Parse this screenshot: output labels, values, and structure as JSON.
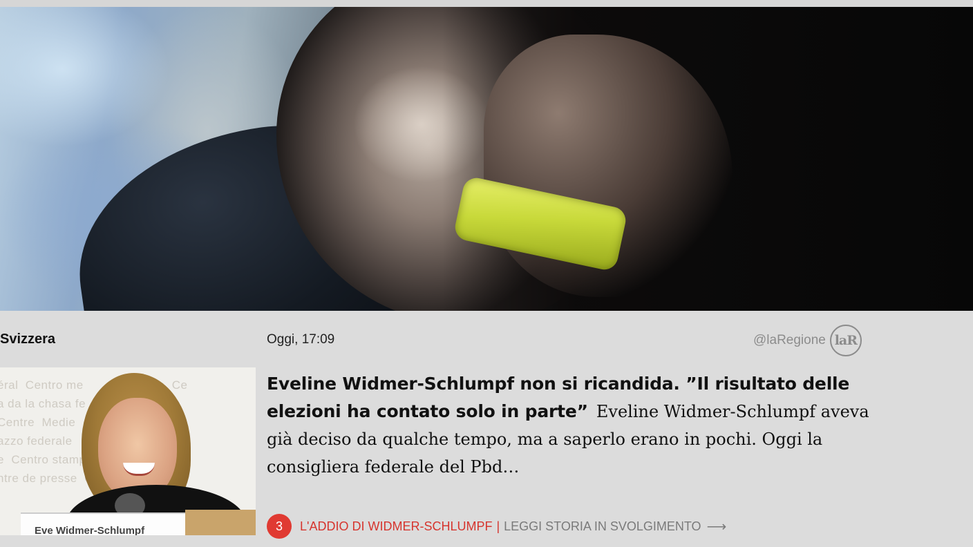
{
  "section": {
    "label": "Svizzera"
  },
  "article": {
    "timestamp": "Oggi, 17:09",
    "source_handle": "@laRegione",
    "source_logo_text": "laR",
    "headline": "Eveline Widmer-Schlumpf non si ricandida. ”Il risultato delle elezioni ha contato solo in parte”",
    "excerpt": "Eveline Widmer-Schlumpf aveva già deciso da qualche tempo, ma a saperlo erano in pochi. Oggi la consigliera federale del Pbd…"
  },
  "story": {
    "count": "3",
    "title": "L'ADDIO DI WIDMER-SCHLUMPF",
    "separator": "|",
    "read_label": "LEGGI STORIA IN SVOLGIMENTO",
    "arrow_icon": "right-arrow-icon"
  },
  "colors": {
    "page_bg": "#dcdcdc",
    "accent_red": "#e03a32",
    "muted_text": "#8c8c8c"
  }
}
